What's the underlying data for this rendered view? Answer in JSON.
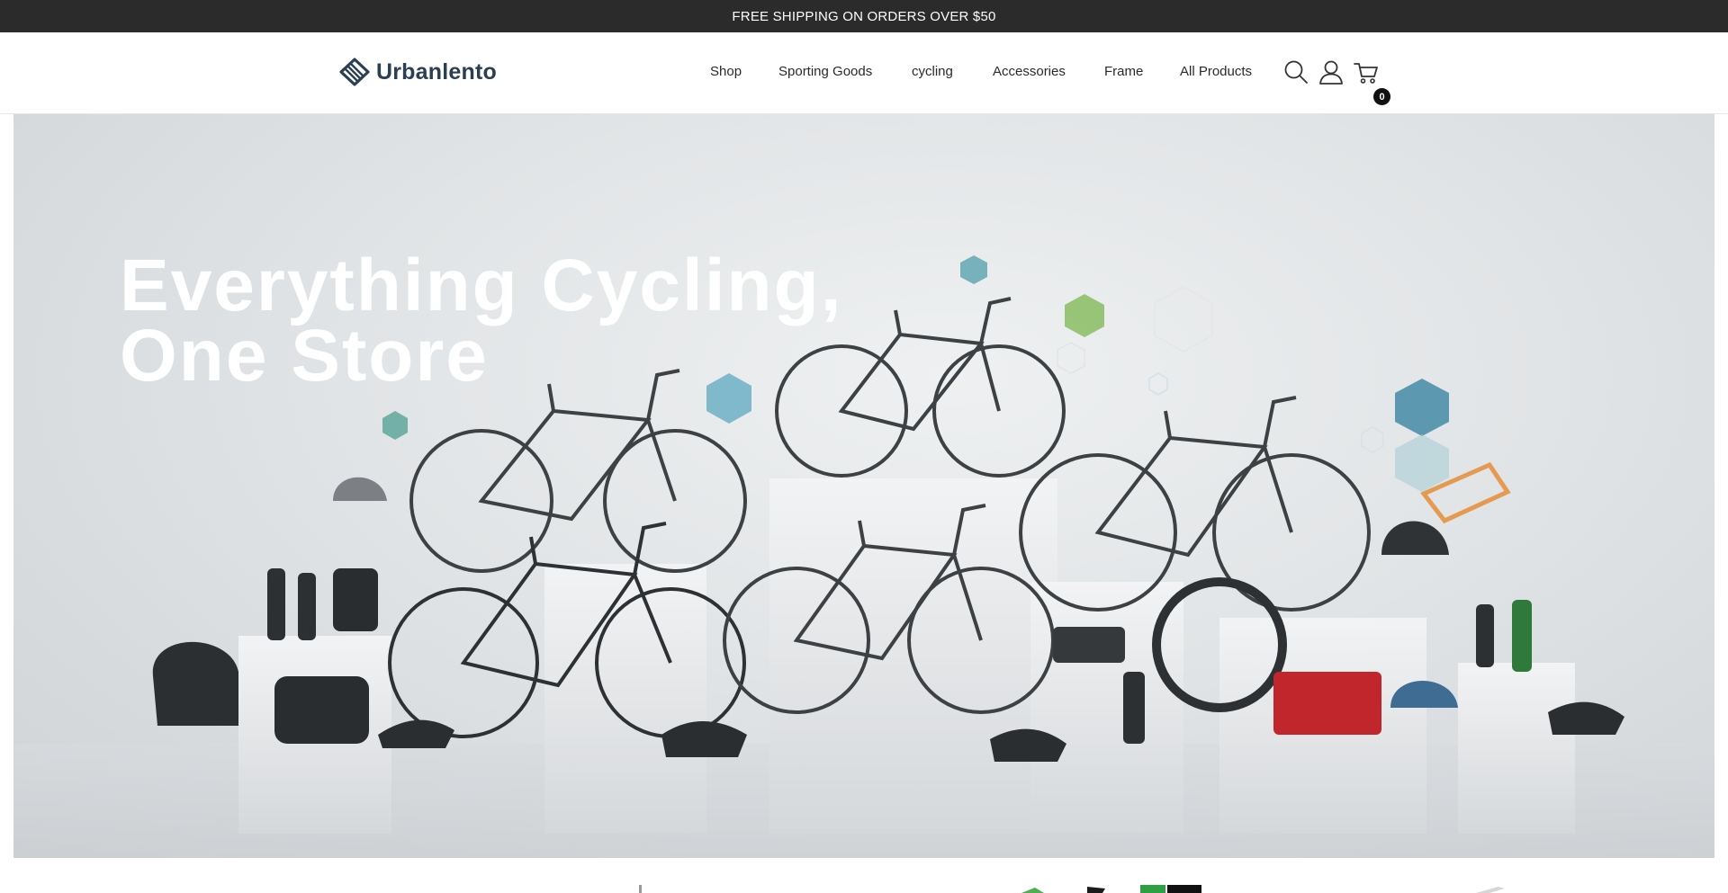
{
  "announcement": {
    "text": "FREE SHIPPING ON ORDERS OVER $50"
  },
  "header": {
    "logo_text": "Urbanlento",
    "nav": [
      {
        "label": "Shop"
      },
      {
        "label": "Sporting Goods"
      },
      {
        "label": "cycling"
      },
      {
        "label": "Accessories"
      },
      {
        "label": "Frame"
      },
      {
        "label": "All Products"
      }
    ],
    "icons": {
      "search": "search-icon",
      "account": "user-icon",
      "cart": "cart-icon"
    },
    "cart_count": "0"
  },
  "hero": {
    "title_line1": "Everything Cycling,",
    "title_line2": "One Store"
  },
  "colors": {
    "announcement_bg": "#2b2b2b",
    "logo": "#2a3f52",
    "hex_green": "#8fc06a",
    "hex_blue": "#4d8fa8",
    "hex_orange": "#e59a52"
  }
}
